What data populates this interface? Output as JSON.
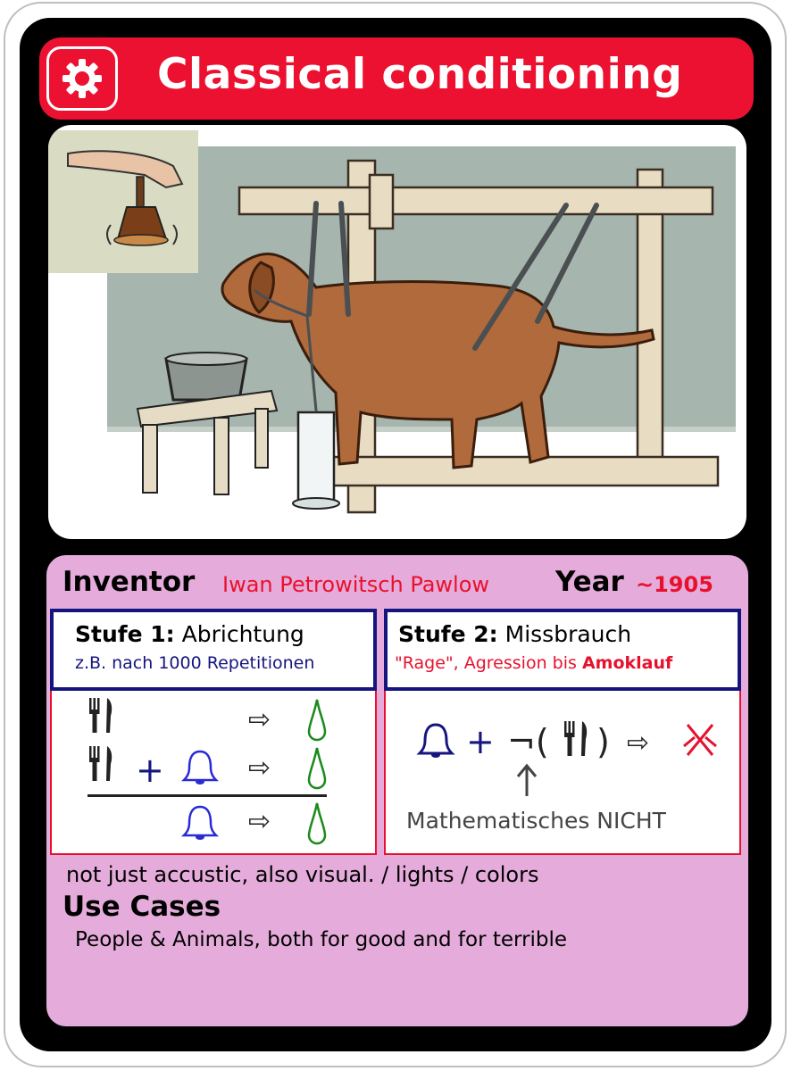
{
  "card": {
    "title": "Classical conditioning",
    "icon": "gear-icon",
    "colors": {
      "title_bar": "#ec1131",
      "info_bg": "#e5acdb",
      "accent_red": "#e8112d",
      "accent_blue": "#151580"
    }
  },
  "inventor": {
    "label": "Inventor",
    "name": "Iwan Petrowitsch Pawlow"
  },
  "year": {
    "label": "Year",
    "value": "~1905"
  },
  "stage1": {
    "title_bold": "Stufe 1:",
    "title_rest": " Abrichtung",
    "subtitle": "z.B. nach 1000 Repetitionen"
  },
  "stage2": {
    "title_bold": "Stufe 2:",
    "title_rest": " Missbrauch",
    "subtitle_plain": "\"Rage\", Agression bis ",
    "subtitle_bold": "Amoklauf",
    "symbols": {
      "plus": "+",
      "not": "¬(",
      "close": ")",
      "implies": "⇨"
    },
    "math_not_label": "Mathematisches NICHT"
  },
  "formula_symbols": {
    "plus": "+",
    "implies": "⇨"
  },
  "note": "not just accustic, also visual. / lights / colors",
  "use_cases": {
    "title": "Use Cases",
    "text": "People & Animals, both for good and for terrible"
  }
}
